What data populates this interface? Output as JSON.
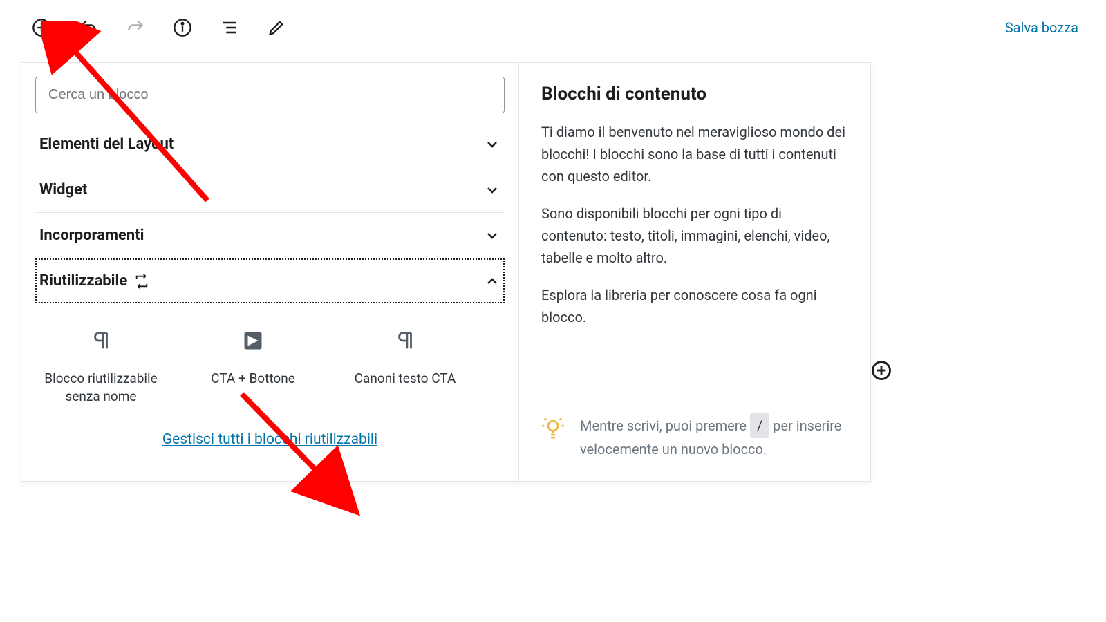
{
  "toolbar": {
    "save_draft": "Salva bozza"
  },
  "inserter": {
    "search_placeholder": "Cerca un blocco",
    "categories": {
      "layout": "Elementi del Layout",
      "widget": "Widget",
      "embed": "Incorporamenti",
      "reusable": "Riutilizzabile"
    },
    "reusable_blocks": [
      {
        "label": "Blocco riutilizzabile senza nome",
        "icon": "paragraph"
      },
      {
        "label": "CTA + Bottone",
        "icon": "block-default"
      },
      {
        "label": "Canoni testo CTA",
        "icon": "paragraph"
      }
    ],
    "manage_link": "Gestisci tutti i blocchi riutilizzabili"
  },
  "info_panel": {
    "title": "Blocchi di contenuto",
    "p1": "Ti diamo il benvenuto nel meraviglioso mondo dei blocchi! I blocchi sono la base di tutti i contenuti con questo editor.",
    "p2": "Sono disponibili blocchi per ogni tipo di contenuto: testo, titoli, immagini, elenchi, video, tabelle e molto altro.",
    "p3": "Esplora la libreria per conoscere cosa fa ogni blocco.",
    "tip_pre": "Mentre scrivi, puoi premere ",
    "tip_key": "/",
    "tip_post": " per inserire velocemente un nuovo blocco."
  }
}
